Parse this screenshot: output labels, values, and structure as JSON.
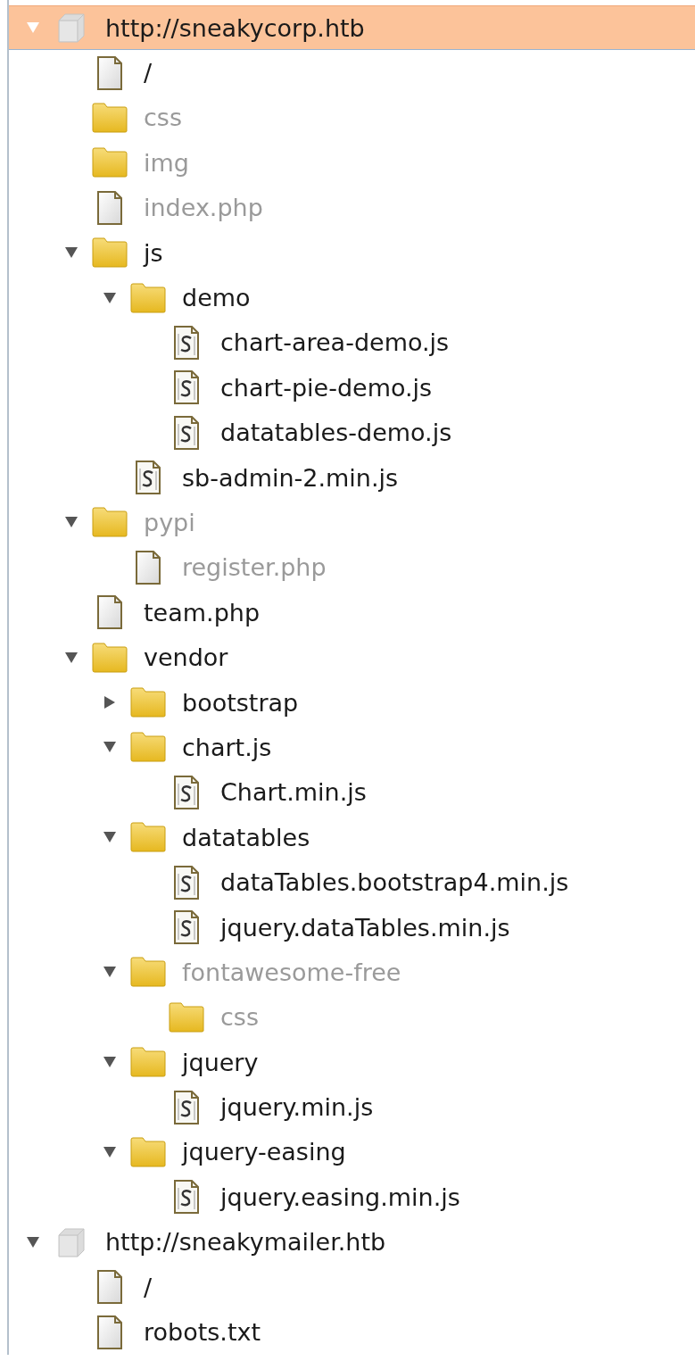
{
  "tree": [
    {
      "label": "http://sneakycorp.htb",
      "kind": "host",
      "selected": true,
      "greyed": false,
      "expanded": true,
      "children": [
        {
          "label": "/",
          "kind": "file",
          "selected": false,
          "greyed": false
        },
        {
          "label": "css",
          "kind": "folder",
          "selected": false,
          "greyed": true
        },
        {
          "label": "img",
          "kind": "folder",
          "selected": false,
          "greyed": true
        },
        {
          "label": "index.php",
          "kind": "file",
          "selected": false,
          "greyed": true
        },
        {
          "label": "js",
          "kind": "folder",
          "selected": false,
          "greyed": false,
          "expanded": true,
          "children": [
            {
              "label": "demo",
              "kind": "folder",
              "selected": false,
              "greyed": false,
              "expanded": true,
              "children": [
                {
                  "label": "chart-area-demo.js",
                  "kind": "script",
                  "selected": false,
                  "greyed": false
                },
                {
                  "label": "chart-pie-demo.js",
                  "kind": "script",
                  "selected": false,
                  "greyed": false
                },
                {
                  "label": "datatables-demo.js",
                  "kind": "script",
                  "selected": false,
                  "greyed": false
                }
              ]
            },
            {
              "label": "sb-admin-2.min.js",
              "kind": "script",
              "selected": false,
              "greyed": false
            }
          ]
        },
        {
          "label": "pypi",
          "kind": "folder",
          "selected": false,
          "greyed": true,
          "expanded": true,
          "children": [
            {
              "label": "register.php",
              "kind": "file",
              "selected": false,
              "greyed": true
            }
          ]
        },
        {
          "label": "team.php",
          "kind": "file",
          "selected": false,
          "greyed": false
        },
        {
          "label": "vendor",
          "kind": "folder",
          "selected": false,
          "greyed": false,
          "expanded": true,
          "children": [
            {
              "label": "bootstrap",
              "kind": "folder",
              "selected": false,
              "greyed": false,
              "expanded": false
            },
            {
              "label": "chart.js",
              "kind": "folder",
              "selected": false,
              "greyed": false,
              "expanded": true,
              "children": [
                {
                  "label": "Chart.min.js",
                  "kind": "script",
                  "selected": false,
                  "greyed": false
                }
              ]
            },
            {
              "label": "datatables",
              "kind": "folder",
              "selected": false,
              "greyed": false,
              "expanded": true,
              "children": [
                {
                  "label": "dataTables.bootstrap4.min.js",
                  "kind": "script",
                  "selected": false,
                  "greyed": false
                },
                {
                  "label": "jquery.dataTables.min.js",
                  "kind": "script",
                  "selected": false,
                  "greyed": false
                }
              ]
            },
            {
              "label": "fontawesome-free",
              "kind": "folder",
              "selected": false,
              "greyed": true,
              "expanded": true,
              "children": [
                {
                  "label": "css",
                  "kind": "folder",
                  "selected": false,
                  "greyed": true
                }
              ]
            },
            {
              "label": "jquery",
              "kind": "folder",
              "selected": false,
              "greyed": false,
              "expanded": true,
              "children": [
                {
                  "label": "jquery.min.js",
                  "kind": "script",
                  "selected": false,
                  "greyed": false
                }
              ]
            },
            {
              "label": "jquery-easing",
              "kind": "folder",
              "selected": false,
              "greyed": false,
              "expanded": true,
              "children": [
                {
                  "label": "jquery.easing.min.js",
                  "kind": "script",
                  "selected": false,
                  "greyed": false
                }
              ]
            }
          ]
        }
      ]
    },
    {
      "label": "http://sneakymailer.htb",
      "kind": "host",
      "selected": false,
      "greyed": false,
      "expanded": true,
      "children": [
        {
          "label": "/",
          "kind": "file",
          "selected": false,
          "greyed": false
        },
        {
          "label": "robots.txt",
          "kind": "file",
          "selected": false,
          "greyed": false
        }
      ]
    }
  ]
}
